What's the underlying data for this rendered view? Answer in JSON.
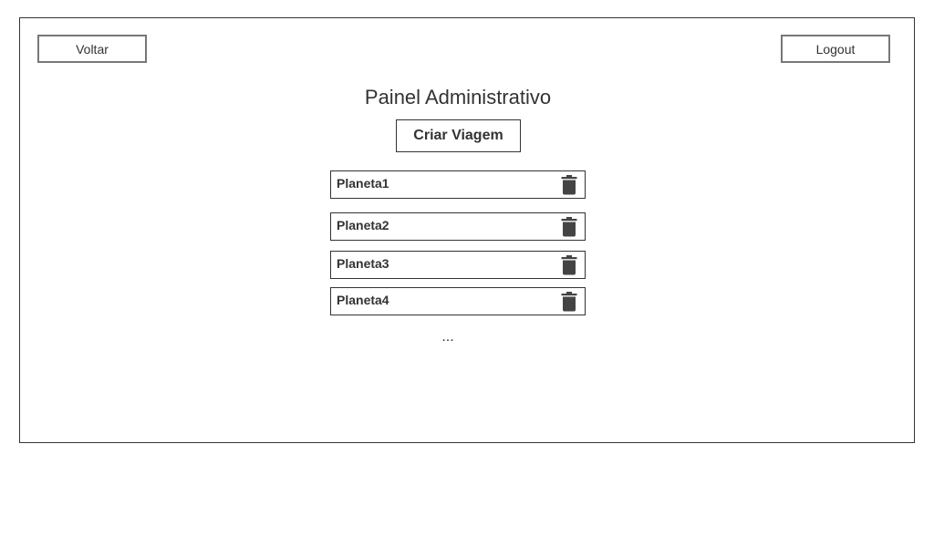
{
  "header": {
    "back_label": "Voltar",
    "logout_label": "Logout"
  },
  "main": {
    "title": "Painel Administrativo",
    "create_label": "Criar Viagem",
    "items": [
      {
        "label": "Planeta1"
      },
      {
        "label": "Planeta2"
      },
      {
        "label": "Planeta3"
      },
      {
        "label": "Planeta4"
      }
    ],
    "more_indicator": "...",
    "delete_icon": "trash-icon"
  }
}
